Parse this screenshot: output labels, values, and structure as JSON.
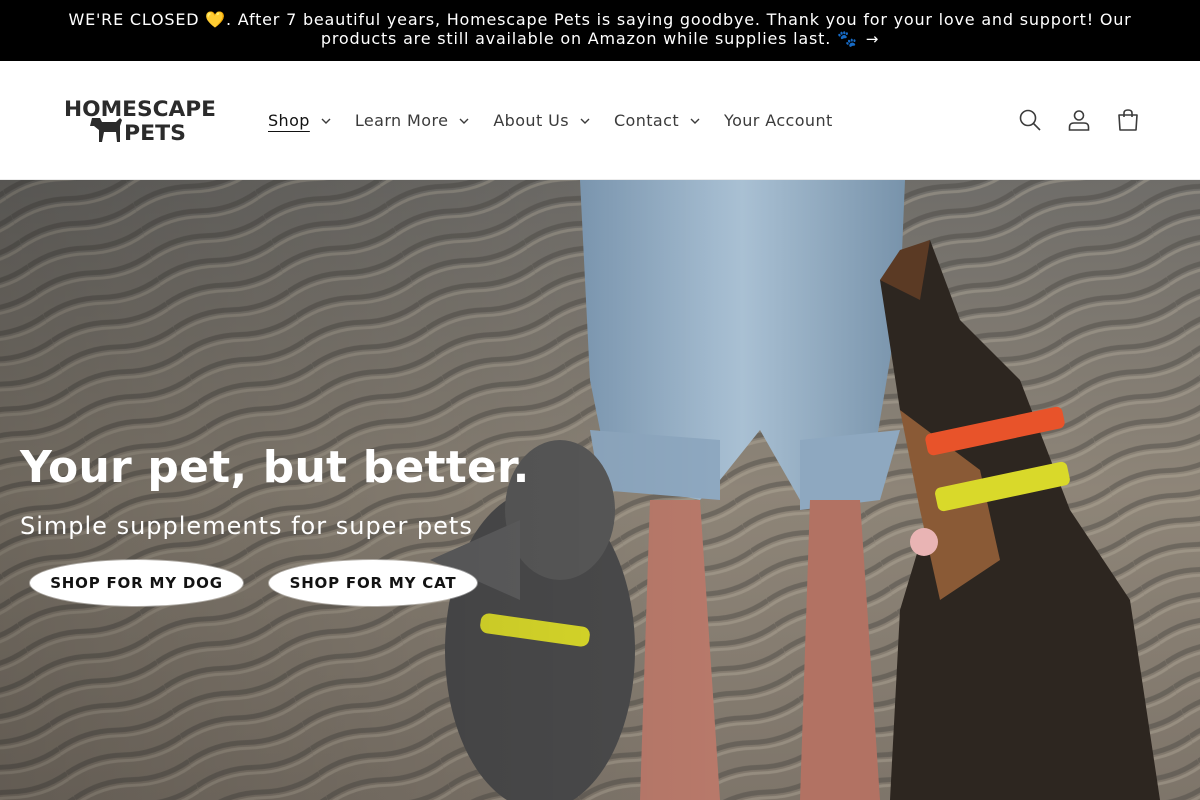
{
  "announcement": {
    "text": "WE'RE CLOSED 💛. After 7 beautiful years, Homescape Pets is saying goodbye. Thank you for your love and support! Our products are still available on Amazon while supplies last. 🐾",
    "arrow": "→"
  },
  "logo": {
    "line1": "HOMESCAPE",
    "line2": "PETS"
  },
  "nav": {
    "items": [
      {
        "label": "Shop",
        "has_dropdown": true,
        "active": true
      },
      {
        "label": "Learn More",
        "has_dropdown": true
      },
      {
        "label": "About Us",
        "has_dropdown": true
      },
      {
        "label": "Contact",
        "has_dropdown": true
      },
      {
        "label": "Your Account",
        "has_dropdown": false
      }
    ]
  },
  "header_icons": [
    "search-icon",
    "account-icon",
    "cart-icon"
  ],
  "hero": {
    "title": "Your pet, but better.",
    "subtitle": "Simple supplements for super pets",
    "buttons": {
      "dog": "SHOP FOR MY DOG",
      "cat": "SHOP FOR MY CAT"
    }
  },
  "colors": {
    "announcement_bg": "#000000",
    "accent_collar_orange": "#e8532a",
    "accent_collar_yellow": "#d9d92a"
  }
}
